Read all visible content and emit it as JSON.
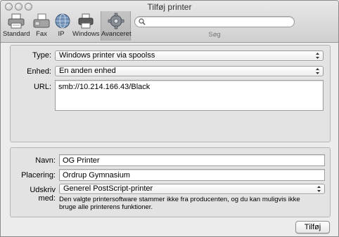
{
  "window": {
    "title": "Tilføj printer"
  },
  "toolbar": {
    "items": [
      {
        "label": "Standard",
        "icon": "printer-icon"
      },
      {
        "label": "Fax",
        "icon": "fax-icon"
      },
      {
        "label": "IP",
        "icon": "globe-icon"
      },
      {
        "label": "Windows",
        "icon": "windows-printer-icon"
      },
      {
        "label": "Avanceret",
        "icon": "gear-icon",
        "active": true
      }
    ],
    "search": {
      "placeholder": "",
      "label": "Søg"
    }
  },
  "connection": {
    "type_label": "Type:",
    "type_value": "Windows printer via spoolss",
    "device_label": "Enhed:",
    "device_value": "En anden enhed",
    "url_label": "URL:",
    "url_value": "smb://10.214.166.43/Black"
  },
  "details": {
    "name_label": "Navn:",
    "name_value": "OG Printer",
    "location_label": "Placering:",
    "location_value": "Ordrup Gymnasium",
    "print_with_label": "Udskriv med:",
    "print_with_value": "Generel PostScript-printer",
    "note": "Den valgte printersoftware stammer ikke fra producenten, og du kan muligvis ikke bruge alle printerens funktioner."
  },
  "buttons": {
    "add": "Tilføj"
  }
}
